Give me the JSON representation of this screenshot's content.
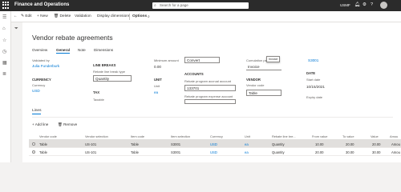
{
  "app": {
    "title": "Finance and Operations",
    "search_placeholder": "Search for a page",
    "company": "USMF"
  },
  "toolbar": {
    "edit": "Edit",
    "new": "+ New",
    "delete": "Delete",
    "validation": "Validation",
    "display_dimensions": "Display dimensions",
    "options": "Options"
  },
  "page": {
    "title": "Vendor rebate agreements",
    "tabs": [
      "Overview",
      "General",
      "Note",
      "Dimensions"
    ],
    "active_tab": "General"
  },
  "form": {
    "validated_by": {
      "label": "Validated by",
      "value": "Julia Funderburk"
    },
    "currency_header": "CURRENCY",
    "currency": {
      "label": "Currency",
      "value": "USD"
    },
    "line_breaks_header": "LINE BREAKS",
    "line_break_type": {
      "label": "Rebate line break type",
      "value": "Quantity"
    },
    "tax_header": "TAX",
    "taxable": {
      "label": "Taxable"
    },
    "minimum_amount": {
      "label": "Minimum amount",
      "value": "0.00"
    },
    "convert": "Convert",
    "unit_header": "UNIT",
    "unit": {
      "label": "Unit",
      "value": "ea"
    },
    "accounts_header": "ACCOUNTS",
    "accrual_account": {
      "label": "Rebate program accrual account",
      "value": "133701"
    },
    "expense_account": {
      "label": "Rebate program expense account",
      "value": ""
    },
    "cumulation_period": {
      "label": "Cumulation period",
      "value": "Invoice"
    },
    "tooltip": "Invoice",
    "vendor_header": "VENDOR",
    "vendor_code": {
      "label": "Vendor code",
      "value": "Table"
    },
    "vendor_account": {
      "label": "",
      "value": "S3001"
    },
    "date_header": "DATE",
    "start_date": {
      "label": "Start date",
      "value": "10/15/2021"
    },
    "expiry_date": {
      "label": "Expiry date"
    }
  },
  "lines": {
    "title": "Lines",
    "add_line": "+ Add line",
    "remove": "Remove",
    "columns": [
      "Vendor code",
      "Vendor selection",
      "Item code",
      "Item selection",
      "Currency",
      "Unit",
      "Rebate line bre...",
      "From value",
      "To value",
      "Value",
      "Amou"
    ],
    "rows": [
      [
        "Table",
        "US-101",
        "Table",
        "S3001",
        "USD",
        "ea",
        "Quantity",
        "10.00",
        "20.00",
        "20.00",
        "Amou"
      ],
      [
        "Table",
        "US-101",
        "Table",
        "S3001",
        "USD",
        "ea",
        "Quantity",
        "20.00",
        "30.00",
        "30.00",
        "Amou"
      ]
    ]
  },
  "colors": {
    "topbar": "#2b2b2b",
    "accent": "#0078d4",
    "selected_row": "#e1dfdd"
  }
}
